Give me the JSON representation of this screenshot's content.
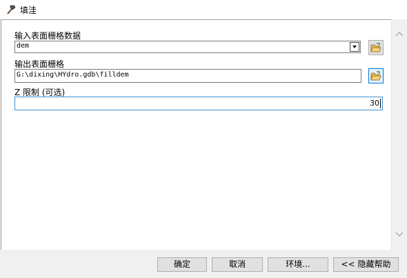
{
  "window": {
    "title": "填洼",
    "icon": "hammer-icon"
  },
  "form": {
    "input_label": "输入表面栅格数据",
    "input_value": "dem",
    "output_label": "输出表面栅格",
    "output_value": "G:\\dixing\\HYdro.gdb\\filldem",
    "z_label": "Z 限制 (可选)",
    "z_value": "30"
  },
  "buttons": {
    "ok": "确定",
    "cancel": "取消",
    "environments": "环境...",
    "hide_help": "<< 隐藏帮助"
  },
  "icons": {
    "browse": "folder-open-icon",
    "scroll_up": "chevron-up-icon",
    "scroll_down": "chevron-down-icon"
  },
  "colors": {
    "focus_border": "#3c8fd6",
    "folder_yellow": "#e8b84a"
  }
}
